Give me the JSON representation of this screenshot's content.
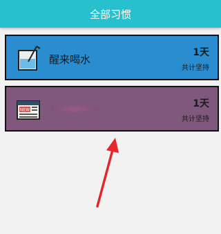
{
  "header": {
    "title": "全部习惯"
  },
  "habits": [
    {
      "name": "醒来喝水",
      "days": "1天",
      "label": "共计坚持",
      "color": "#2a8dd0",
      "icon": "water-cup-icon"
    },
    {
      "name": "",
      "days": "1天",
      "label": "共计坚持",
      "color": "#81587d",
      "icon": "newspaper-icon"
    }
  ]
}
